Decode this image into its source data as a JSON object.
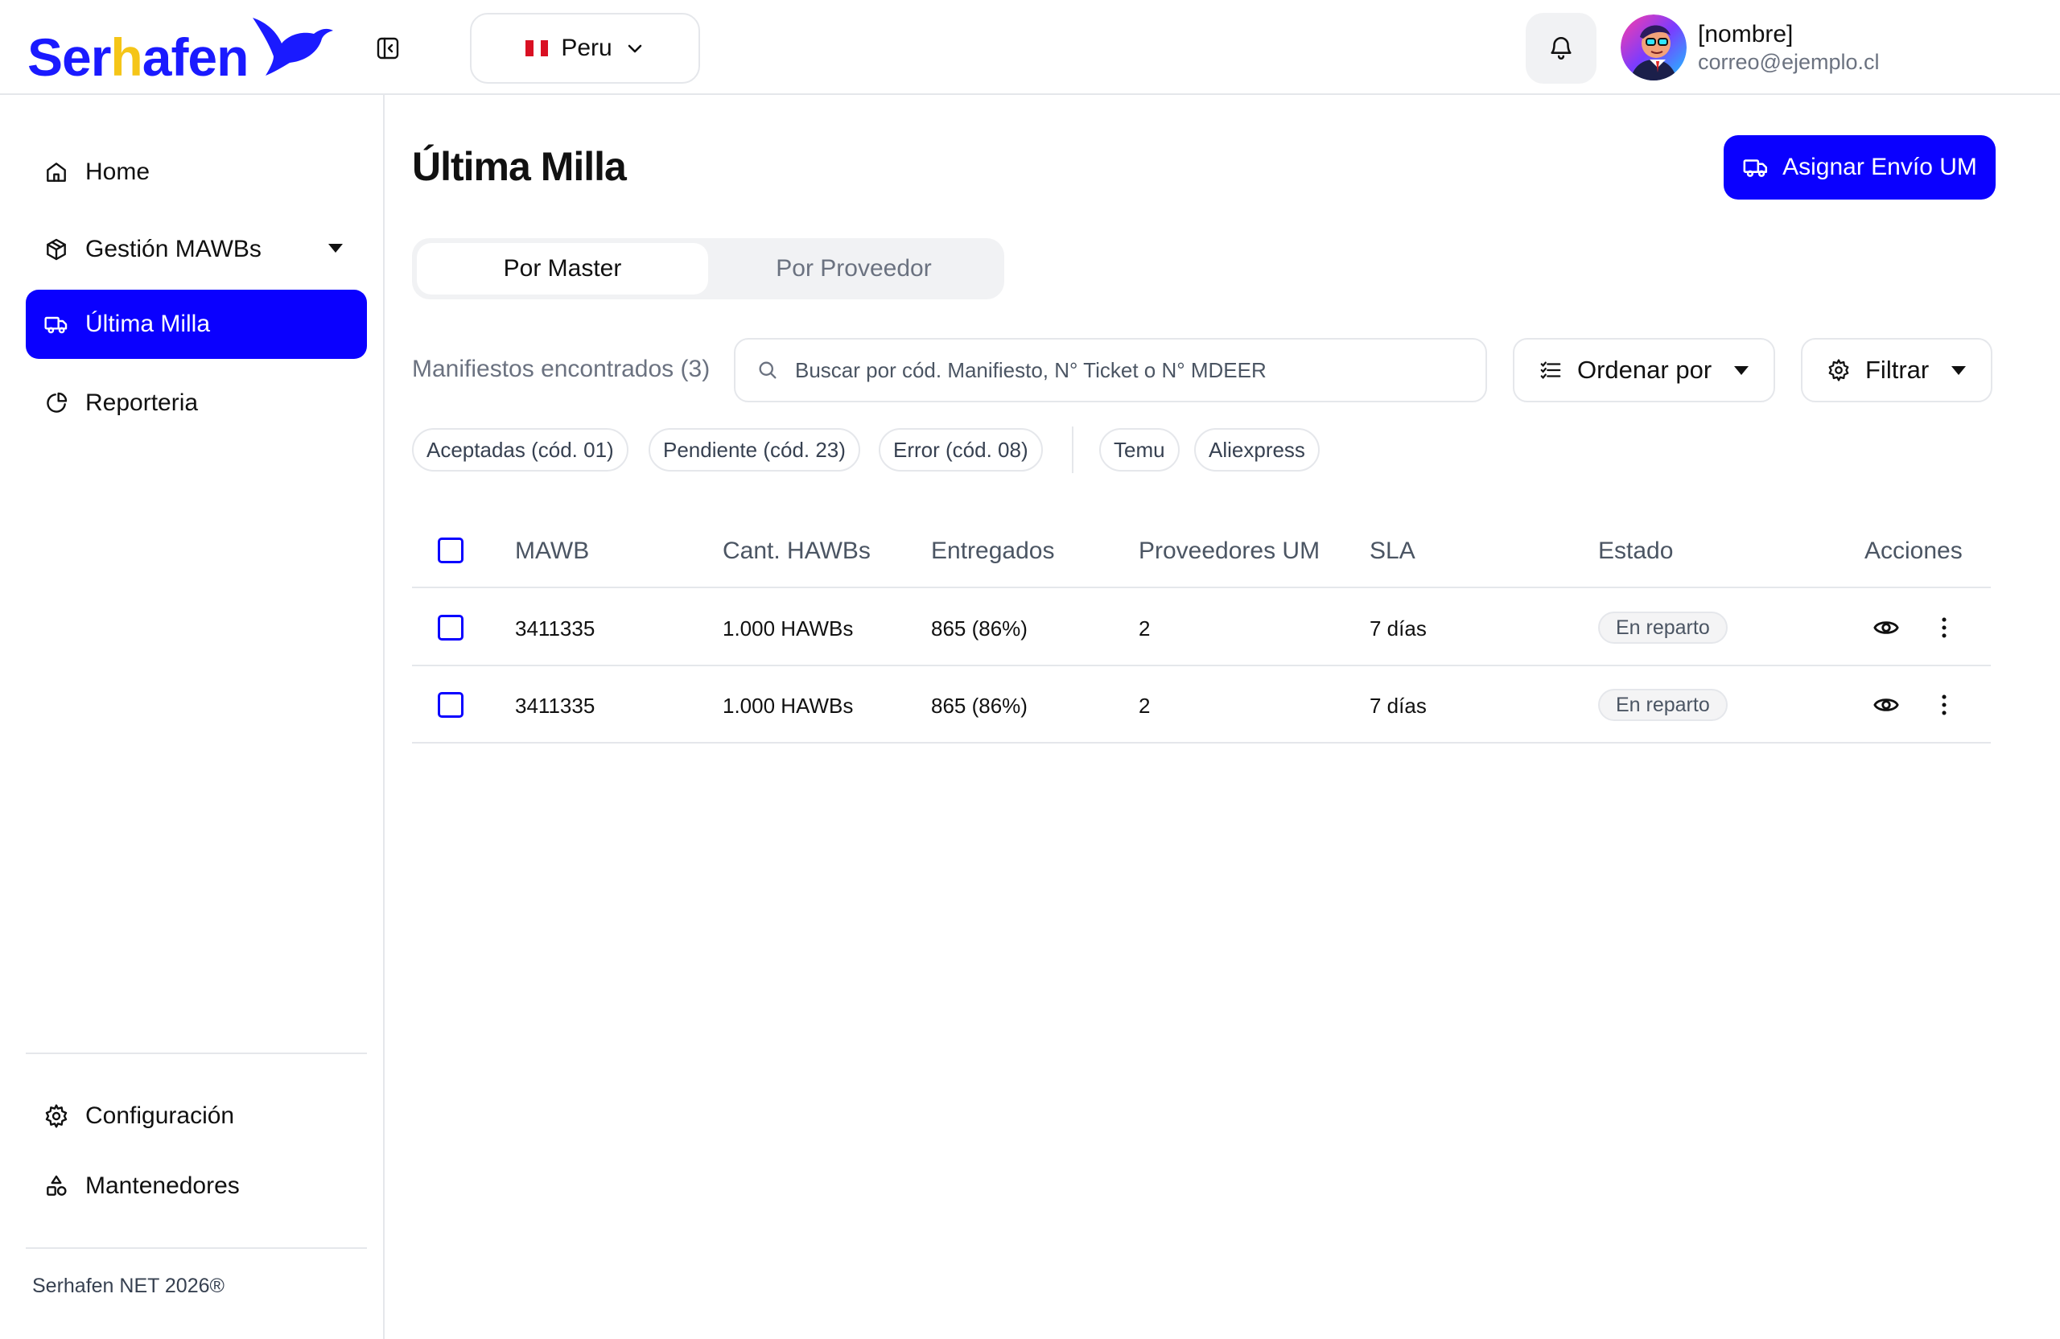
{
  "header": {
    "logo_text_pre": "Ser",
    "logo_text_h": "h",
    "logo_text_post": "afen",
    "country": "Peru",
    "user_name": "[nombre]",
    "user_email": "correo@ejemplo.cl"
  },
  "sidebar": {
    "items": [
      {
        "label": "Home",
        "icon": "home-icon"
      },
      {
        "label": "Gestión MAWBs",
        "icon": "box-icon"
      },
      {
        "label": "Última Milla",
        "icon": "truck-icon"
      },
      {
        "label": "Reporteria",
        "icon": "pie-chart-icon"
      }
    ],
    "bottom_items": [
      {
        "label": "Configuración",
        "icon": "gear-icon"
      },
      {
        "label": "Mantenedores",
        "icon": "shapes-icon"
      }
    ],
    "footer": "Serhafen NET 2026®"
  },
  "main": {
    "title": "Última Milla",
    "primary_action": "Asignar Envío UM",
    "tabs": [
      "Por Master",
      "Por Proveedor"
    ],
    "found_label": "Manifiestos encontrados (3)",
    "search_placeholder": "Buscar por cód. Manifiesto, N° Ticket o N° MDEER",
    "sort_label": "Ordenar por",
    "filter_label": "Filtrar",
    "chips": [
      "Aceptadas (cód. 01)",
      "Pendiente (cód. 23)",
      "Error (cód. 08)",
      "Temu",
      "Aliexpress"
    ]
  },
  "table": {
    "columns": [
      "MAWB",
      "Cant. HAWBs",
      "Entregados",
      "Proveedores UM",
      "SLA",
      "Estado",
      "Acciones"
    ],
    "rows": [
      {
        "mawb": "3411335",
        "hawbs": "1.000 HAWBs",
        "delivered": "865 (86%)",
        "providers": "2",
        "sla": "7 días",
        "status": "En reparto"
      },
      {
        "mawb": "3411335",
        "hawbs": "1.000 HAWBs",
        "delivered": "865 (86%)",
        "providers": "2",
        "sla": "7 días",
        "status": "En reparto"
      }
    ]
  },
  "colors": {
    "brand": "#0a00ff",
    "logo_accent": "#f5c518",
    "border": "#e5e7eb"
  }
}
